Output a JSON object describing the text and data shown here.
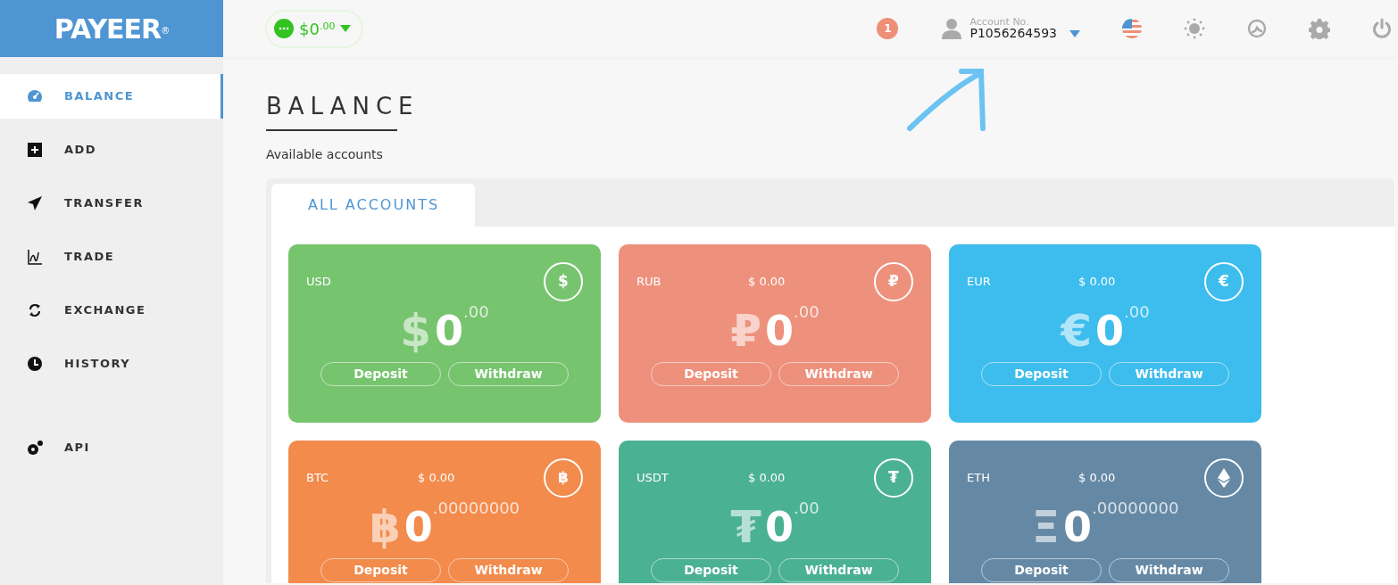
{
  "logo": {
    "text": "PAYEER",
    "mark": "®"
  },
  "balance_pill": {
    "amount": "$0$^{.00}$"
  },
  "header": {
    "notifications": "1",
    "account_label": "Account No.",
    "account_number": "P1056264593"
  },
  "sidebar": {
    "items": [
      {
        "label": "BALANCE",
        "selected": true
      },
      {
        "label": "ADD",
        "selected": false
      },
      {
        "label": "TRANSFER",
        "selected": false
      },
      {
        "label": "TRADE",
        "selected": false
      },
      {
        "label": "EXCHANGE",
        "selected": false
      },
      {
        "label": "HISTORY",
        "selected": false
      },
      {
        "label": "API",
        "selected": false
      }
    ]
  },
  "page": {
    "title": "BALANCE",
    "subtitle": "Available accounts"
  },
  "tabs": [
    {
      "label": "ALL ACCOUNTS",
      "selected": true
    }
  ],
  "accounts": [
    {
      "code": "USD",
      "color": "#77c46f",
      "symbol": "$",
      "badge": "$",
      "amount": "0",
      "fraction": ".00",
      "buttons": [
        "Deposit",
        "Withdraw"
      ]
    },
    {
      "code": "RUB",
      "color": "#ed917d",
      "usd_value": "$ 0.00",
      "symbol": "₽",
      "badge": "₽",
      "amount": "0",
      "fraction": ".00",
      "buttons": [
        "Deposit",
        "Withdraw"
      ]
    },
    {
      "code": "EUR",
      "color": "#3dbdee",
      "usd_value": "$ 0.00",
      "symbol": "€",
      "badge": "€",
      "amount": "0",
      "fraction": ".00",
      "buttons": [
        "Deposit",
        "Withdraw"
      ]
    },
    {
      "code": "BTC",
      "color": "#f28b4c",
      "usd_value": "$ 0.00",
      "symbol": "฿",
      "badge": "฿",
      "amount": "0",
      "fraction": ".00000000",
      "buttons": [
        "Deposit",
        "Withdraw"
      ]
    },
    {
      "code": "USDT",
      "color": "#4bb193",
      "usd_value": "$ 0.00",
      "symbol": "₮",
      "badge": "₮",
      "amount": "0",
      "fraction": ".00",
      "buttons": [
        "Deposit",
        "Withdraw"
      ]
    },
    {
      "code": "ETH",
      "color": "#6589a5",
      "usd_value": "$ 0.00",
      "symbol": "Ξ",
      "amount": "0",
      "fraction": ".00000000",
      "buttons": [
        "Deposit",
        "Withdraw"
      ]
    }
  ]
}
